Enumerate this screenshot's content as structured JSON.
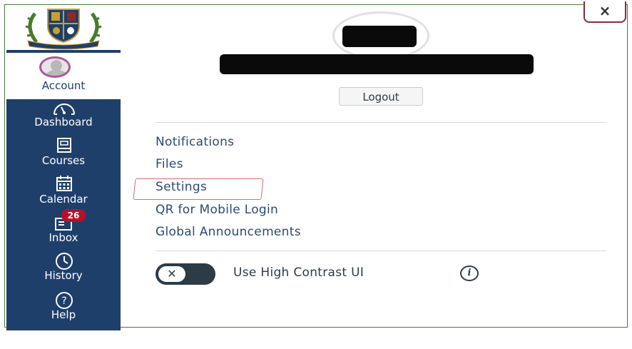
{
  "nav": {
    "account_label": "Account",
    "items": [
      {
        "label": "Dashboard",
        "icon": "dashboard-icon"
      },
      {
        "label": "Courses",
        "icon": "courses-icon"
      },
      {
        "label": "Calendar",
        "icon": "calendar-icon"
      },
      {
        "label": "Inbox",
        "icon": "inbox-icon",
        "badge": "26"
      },
      {
        "label": "History",
        "icon": "history-icon"
      },
      {
        "label": "Help",
        "icon": "help-icon"
      }
    ]
  },
  "tray": {
    "close_label": "×",
    "logout_label": "Logout",
    "links": [
      "Notifications",
      "Files",
      "Settings",
      "QR for Mobile Login",
      "Global Announcements"
    ],
    "toggle_symbol": "✕",
    "toggle_label": "Use High Contrast UI",
    "info_symbol": "i"
  },
  "colors": {
    "nav_bg": "#1f3f6b",
    "link": "#2b4a78",
    "badge": "#b5122a",
    "settings_highlight": "#e06a6a"
  }
}
